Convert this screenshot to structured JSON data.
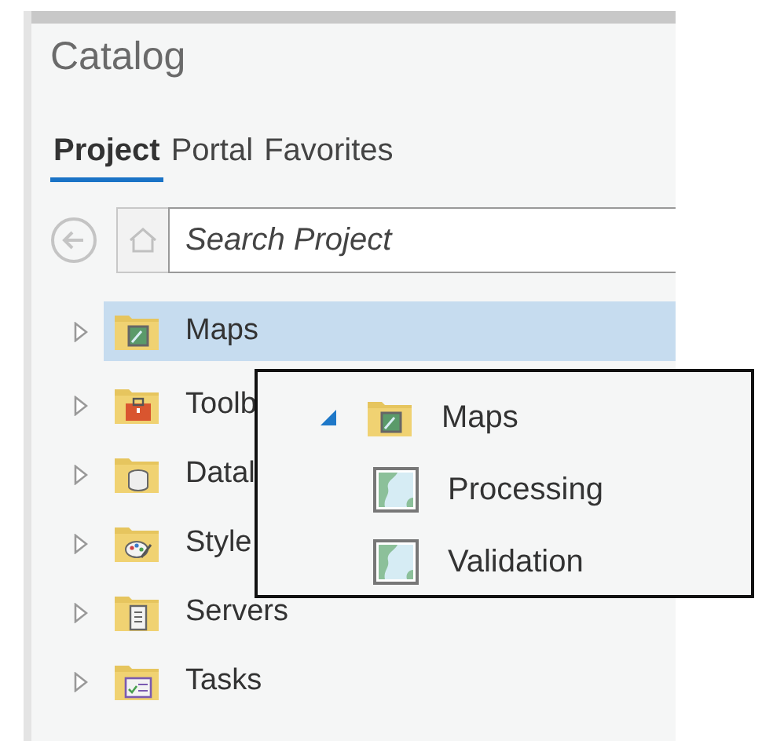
{
  "panel": {
    "title": "Catalog",
    "tabs": [
      {
        "label": "Project",
        "selected": true
      },
      {
        "label": "Portal",
        "selected": false
      },
      {
        "label": "Favorites",
        "selected": false
      }
    ],
    "search": {
      "placeholder": "Search Project"
    },
    "tree": [
      {
        "label": "Maps",
        "kind": "maps",
        "selected": true,
        "expanded": false
      },
      {
        "label": "Toolb",
        "kind": "toolboxes",
        "selected": false,
        "expanded": false
      },
      {
        "label": "Datal",
        "kind": "databases",
        "selected": false,
        "expanded": false
      },
      {
        "label": "Style",
        "kind": "styles",
        "selected": false,
        "expanded": false
      },
      {
        "label": "Servers",
        "kind": "servers",
        "selected": false,
        "expanded": false
      },
      {
        "label": "Tasks",
        "kind": "tasks",
        "selected": false,
        "expanded": false
      }
    ]
  },
  "popup": {
    "tree": [
      {
        "label": "Maps",
        "kind": "maps",
        "expanded": true,
        "children": [
          {
            "label": "Processing",
            "kind": "map"
          },
          {
            "label": "Validation",
            "kind": "map"
          }
        ]
      }
    ]
  }
}
